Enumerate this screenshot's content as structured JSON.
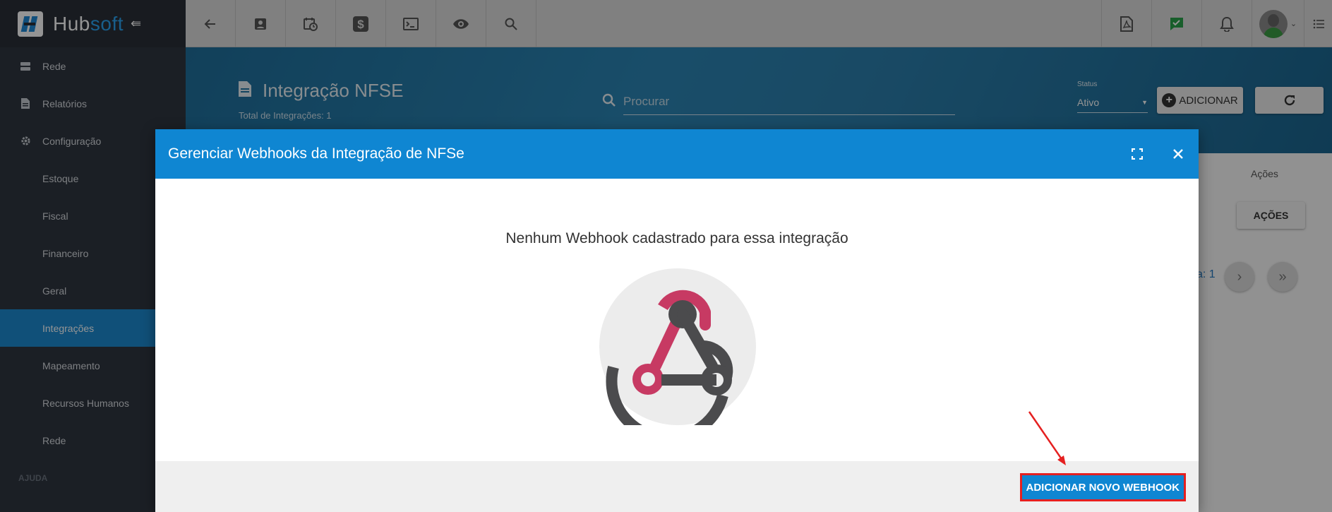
{
  "brand": {
    "name_part1": "Hub",
    "name_part2": "soft"
  },
  "sidebar": {
    "items": [
      {
        "label": "Rede",
        "icon": "server-icon"
      },
      {
        "label": "Relatórios",
        "icon": "document-icon"
      },
      {
        "label": "Configuração",
        "icon": "gear-icon"
      },
      {
        "label": "Estoque"
      },
      {
        "label": "Fiscal"
      },
      {
        "label": "Financeiro"
      },
      {
        "label": "Geral"
      },
      {
        "label": "Integrações",
        "active": true
      },
      {
        "label": "Mapeamento"
      },
      {
        "label": "Recursos Humanos"
      },
      {
        "label": "Rede"
      }
    ],
    "section_help": "AJUDA"
  },
  "header": {
    "title": "Integração NFSE",
    "subtitle": "Total de Integrações: 1",
    "search_placeholder": "Procurar",
    "status_label": "Status",
    "status_value": "Ativo",
    "add_button": "ADICIONAR"
  },
  "table": {
    "col_actions": "Ações",
    "actions_button": "AÇÕES",
    "page_info": "a: 1"
  },
  "modal": {
    "title": "Gerenciar Webhooks da Integração de NFSe",
    "empty_message": "Nenhum Webhook cadastrado para essa integração",
    "add_webhook_button": "ADICIONAR NOVO WEBHOOK"
  },
  "colors": {
    "primary": "#0f86d2",
    "sidebar": "#2f3640",
    "webhook_pink": "#c73a63",
    "webhook_dark": "#4b4b4d",
    "highlight_red": "#e52020"
  }
}
